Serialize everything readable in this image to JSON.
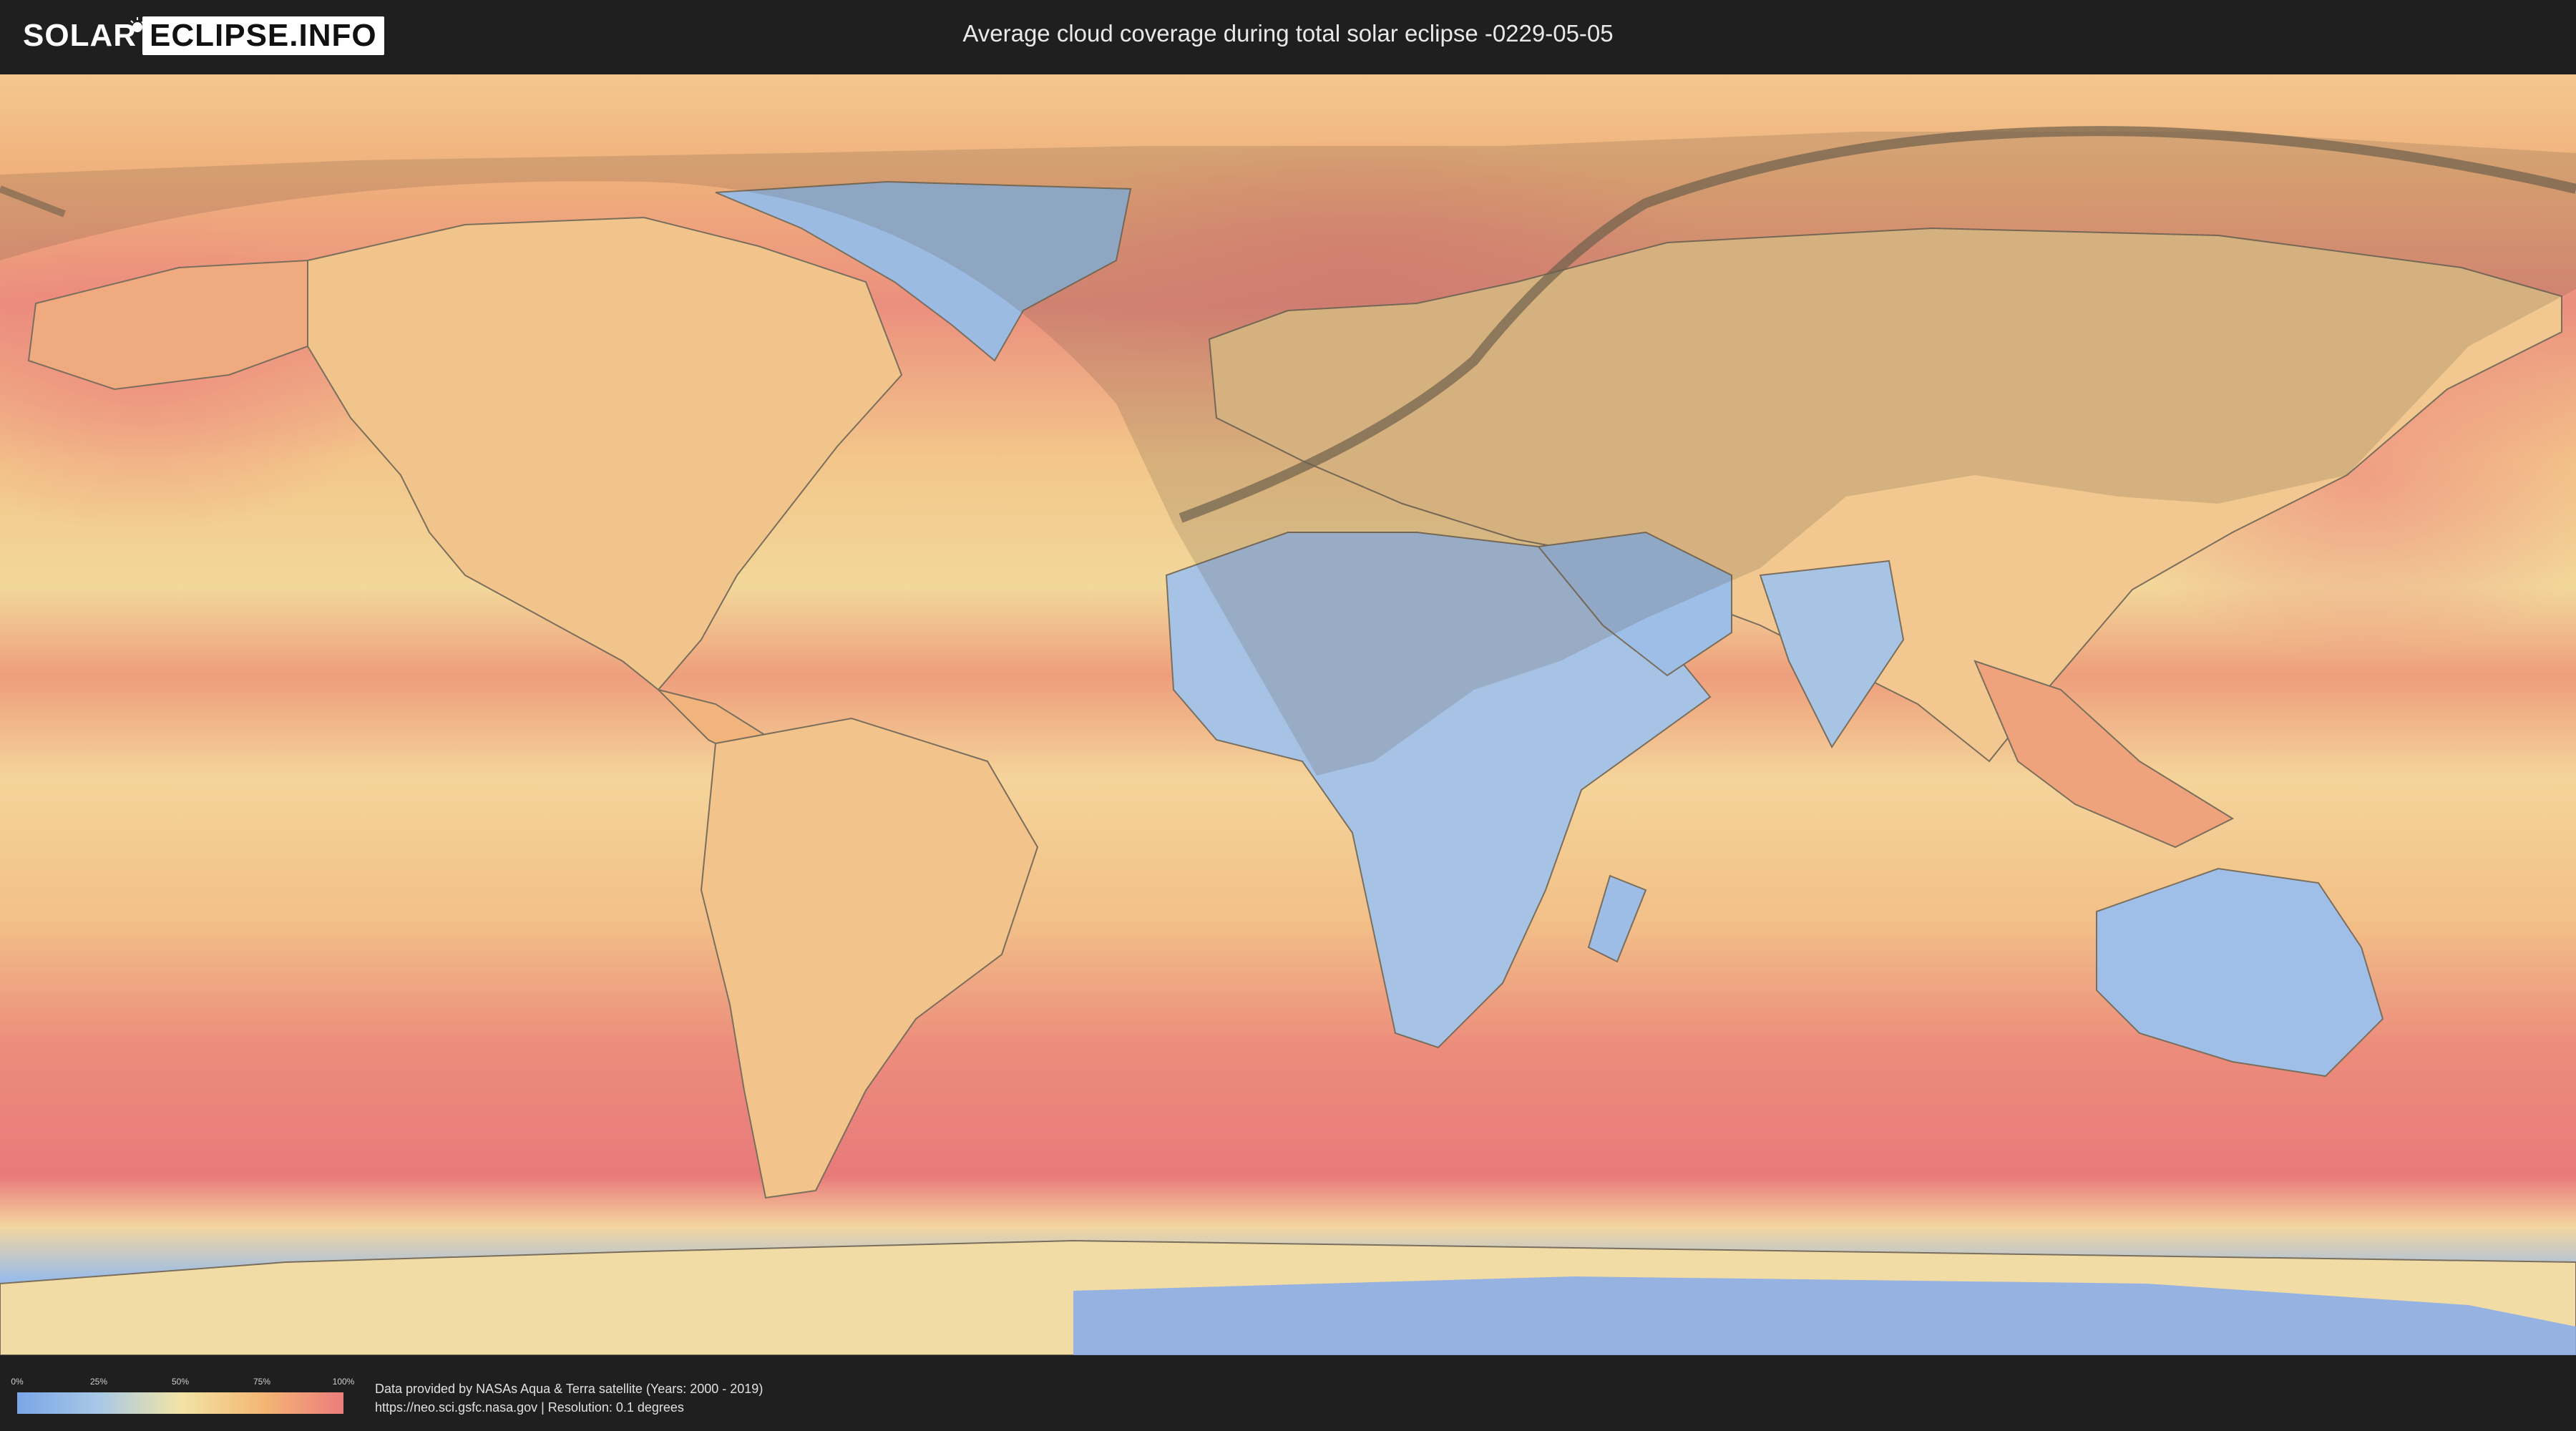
{
  "header": {
    "logo_part1": "SOLAR",
    "logo_part2": "ECLIPSE.INFO",
    "title": "Average cloud coverage during total solar eclipse -0229-05-05"
  },
  "legend": {
    "ticks": [
      "0%",
      "25%",
      "50%",
      "75%",
      "100%"
    ],
    "colors": [
      "#7aa6e8",
      "#a8c8e6",
      "#f2e4a6",
      "#f4b774",
      "#ec7d7d"
    ]
  },
  "footer": {
    "credit_line1": "Data provided by NASAs Aqua & Terra satellite (Years: 2000 - 2019)",
    "credit_line2": "https://neo.sci.gsfc.nasa.gov | Resolution: 0.1 degrees"
  },
  "map": {
    "layers": [
      "cloud-coverage",
      "coastlines",
      "eclipse-visibility-zone",
      "eclipse-path"
    ]
  }
}
